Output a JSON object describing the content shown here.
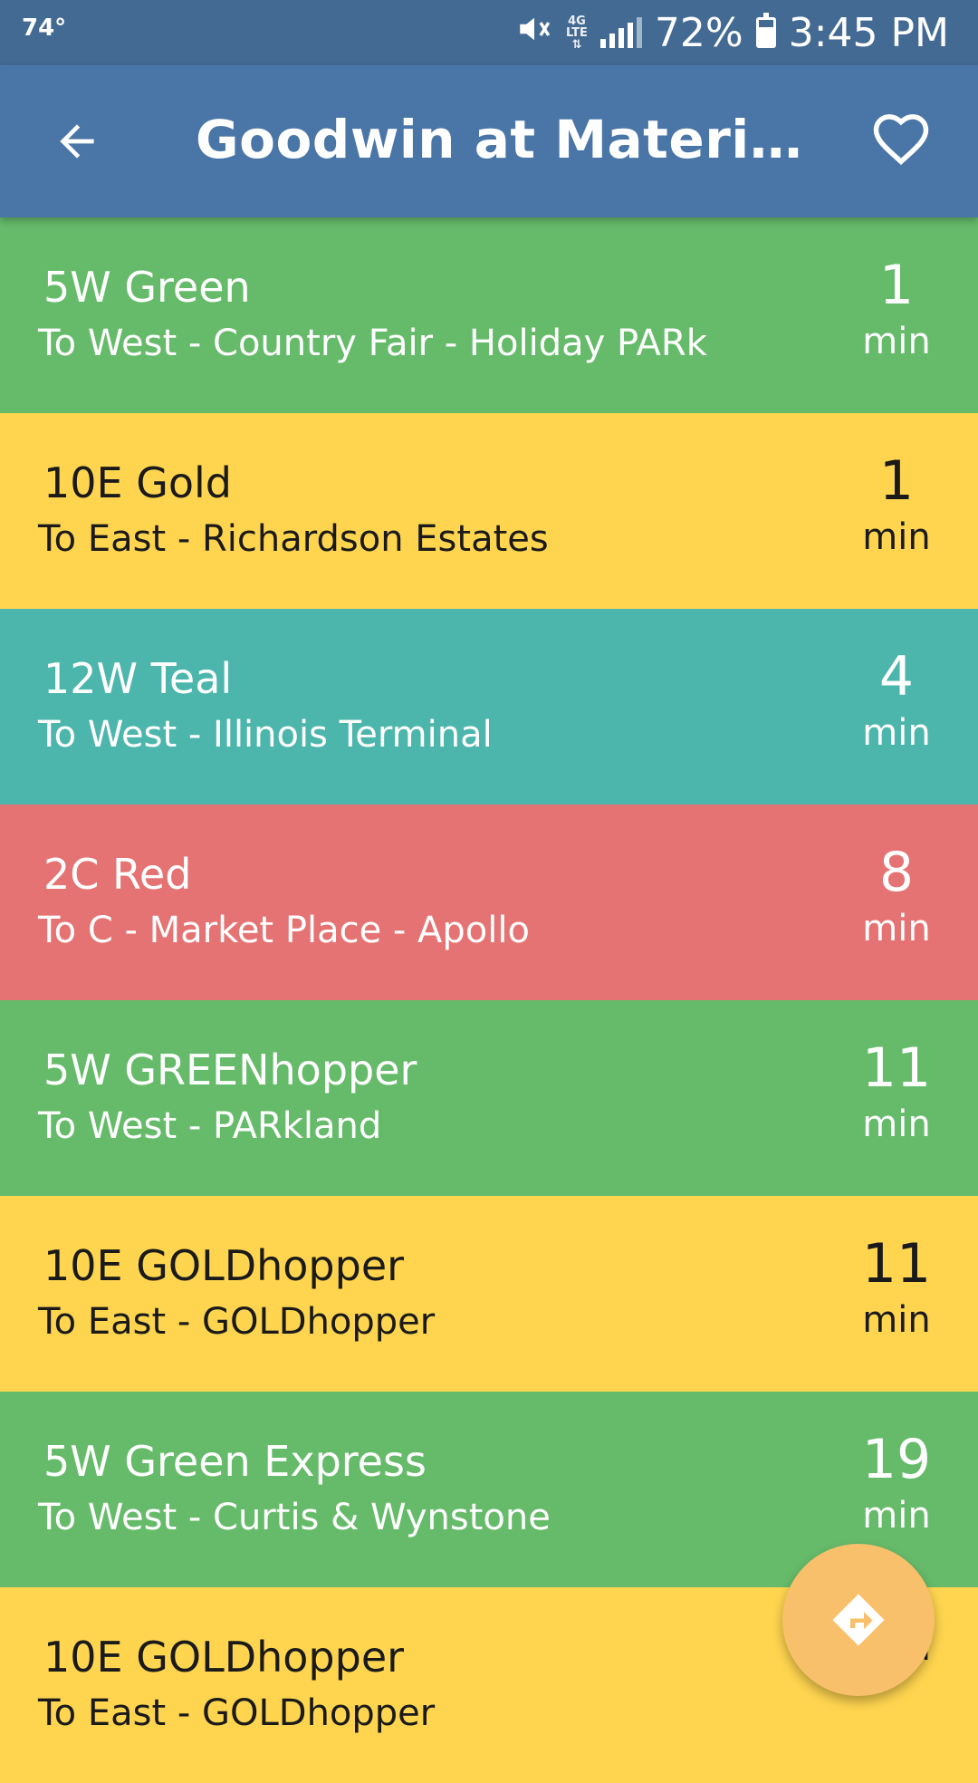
{
  "status_bar": {
    "temperature": "74°",
    "battery": "72%",
    "time": "3:45 PM",
    "network": "4G LTE"
  },
  "app_bar": {
    "title": "Goodwin at Materials Re...",
    "back_icon": "arrow-left-icon",
    "favorite_icon": "heart-outline-icon"
  },
  "departures": [
    {
      "route": "5W Green",
      "destination": "To West - Country Fair - Holiday PARk",
      "minutes": "1",
      "unit": "min",
      "color": "#66bb6a"
    },
    {
      "route": "10E Gold",
      "destination": "To East - Richardson Estates",
      "minutes": "1",
      "unit": "min",
      "color": "#ffd54f"
    },
    {
      "route": "12W Teal",
      "destination": "To West - Illinois Terminal",
      "minutes": "4",
      "unit": "min",
      "color": "#4db6ac"
    },
    {
      "route": "2C Red",
      "destination": "To C - Market Place - Apollo",
      "minutes": "8",
      "unit": "min",
      "color": "#e57373"
    },
    {
      "route": "5W GREENhopper",
      "destination": "To West - PARkland",
      "minutes": "11",
      "unit": "min",
      "color": "#66bb6a"
    },
    {
      "route": "10E GOLDhopper",
      "destination": "To East - GOLDhopper",
      "minutes": "11",
      "unit": "min",
      "color": "#ffd54f"
    },
    {
      "route": "5W Green Express",
      "destination": "To West - Curtis & Wynstone",
      "minutes": "19",
      "unit": "min",
      "color": "#66bb6a"
    },
    {
      "route": "10E GOLDhopper",
      "destination": "To East - GOLDhopper",
      "minutes": "",
      "unit": "min",
      "color": "#ffd54f"
    }
  ],
  "fab": {
    "icon": "directions-icon",
    "color": "#f9c06b"
  }
}
